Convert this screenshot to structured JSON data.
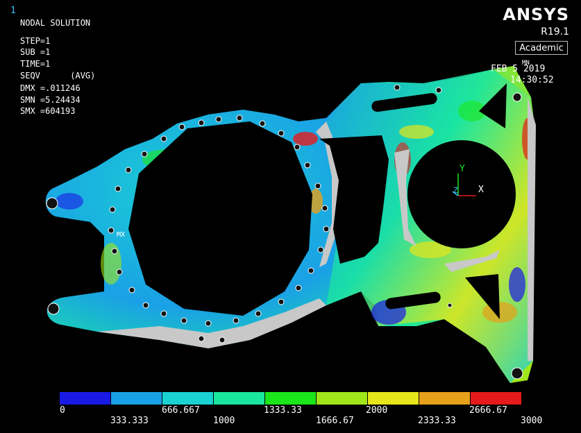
{
  "window_number": "1",
  "info_lines": [
    "NODAL SOLUTION",
    "STEP=1",
    "SUB =1",
    "TIME=1",
    "SEQV      (AVG)",
    "DMX =.011246",
    "SMN =5.24434",
    "SMX =604193"
  ],
  "brand": {
    "logo": "ANSYS",
    "version": "R19.1",
    "edition": "Academic"
  },
  "datetime": {
    "date": "FEB 5 2019",
    "time": "14:30:52"
  },
  "triad": {
    "y_label": "Y",
    "z_label": "Z",
    "x_label": "X"
  },
  "mx_marker": "MX",
  "mn_marker": "MN",
  "legend": {
    "colors": [
      "#1a1ae6",
      "#1aa0e6",
      "#1ad2d2",
      "#1ae6a0",
      "#1ae61a",
      "#a0e61a",
      "#e6e61a",
      "#e6a01a",
      "#e61a1a"
    ],
    "top_labels": [
      "0",
      "666.667",
      "1333.33",
      "2000",
      "2666.67"
    ],
    "bottom_labels": [
      "333.333",
      "1000",
      "1666.67",
      "2333.33",
      "3000"
    ]
  },
  "colors": {
    "window_number": "#38c0ff",
    "background": "#000000",
    "overlimit": "#c8c8c8"
  }
}
